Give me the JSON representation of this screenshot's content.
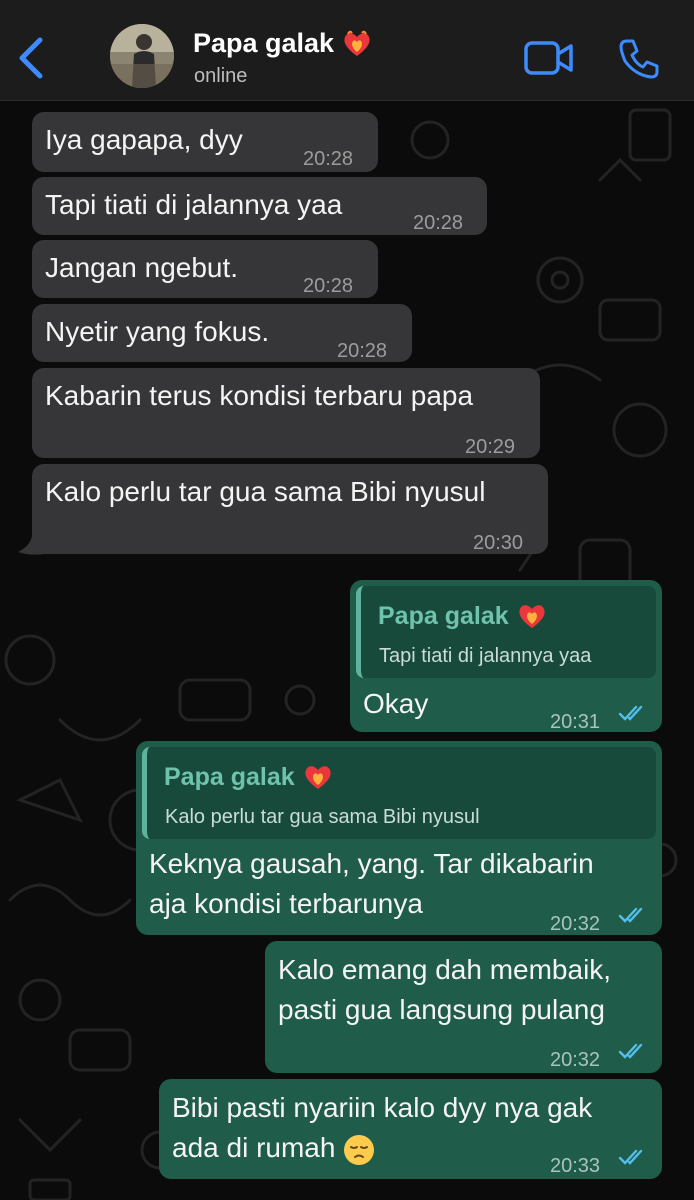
{
  "header": {
    "contact_name": "Papa galak",
    "status": "online"
  },
  "messages": [
    {
      "direction": "incoming",
      "text": "Iya gapapa, dyy",
      "time": "20:28"
    },
    {
      "direction": "incoming",
      "text": "Tapi tiati di jalannya yaa",
      "time": "20:28"
    },
    {
      "direction": "incoming",
      "text": "Jangan ngebut.",
      "time": "20:28"
    },
    {
      "direction": "incoming",
      "text": "Nyetir yang fokus.",
      "time": "20:28"
    },
    {
      "direction": "incoming",
      "text": "Kabarin terus kondisi terbaru papa",
      "time": "20:29"
    },
    {
      "direction": "incoming",
      "text": "Kalo perlu tar gua sama Bibi nyusul",
      "time": "20:30"
    },
    {
      "direction": "outgoing",
      "quote_name": "Papa galak",
      "quote_text": "Tapi tiati di jalannya yaa",
      "text": "Okay",
      "time": "20:31",
      "status": "read"
    },
    {
      "direction": "outgoing",
      "quote_name": "Papa galak",
      "quote_text": "Kalo perlu tar gua sama Bibi nyusul",
      "lines": [
        "Keknya gausah, yang. Tar dikabarin",
        "aja kondisi terbarunya"
      ],
      "time": "20:32",
      "status": "read"
    },
    {
      "direction": "outgoing",
      "lines": [
        "Kalo emang dah membaik,",
        "pasti gua langsung pulang"
      ],
      "time": "20:32",
      "status": "read"
    },
    {
      "direction": "outgoing",
      "lines": [
        "Bibi pasti nyariin kalo dyy nya gak",
        "ada di rumah"
      ],
      "trailing_emoji": "pensive-face",
      "time": "20:33",
      "status": "read"
    }
  ],
  "colors": {
    "accent": "#3d8bff",
    "incoming_bubble": "#363638",
    "outgoing_bubble": "#1f5c4a",
    "quote_name": "#6fc3ad",
    "read_ticks": "#53bdeb"
  },
  "icons": {
    "back": "chevron-left-icon",
    "video": "video-camera-icon",
    "call": "phone-icon",
    "contact_emoji": "heart-on-fire-icon"
  }
}
